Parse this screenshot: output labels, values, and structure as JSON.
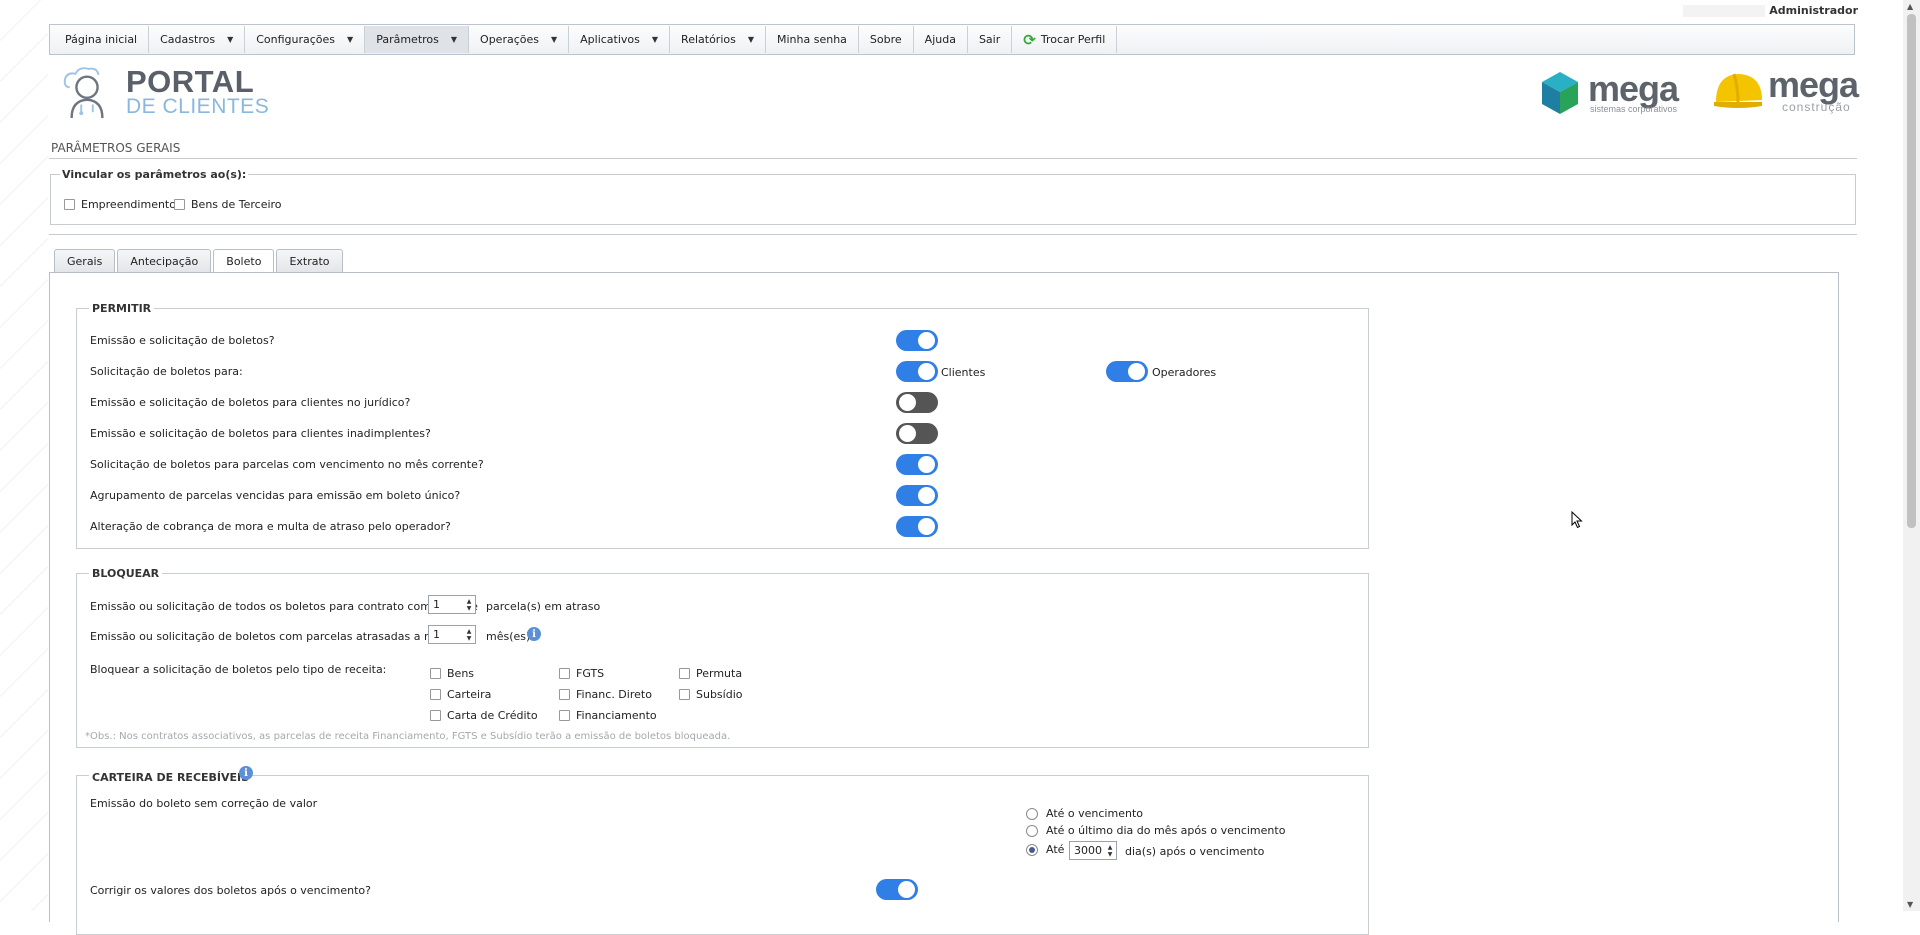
{
  "user": {
    "name": "Administrador"
  },
  "menu": [
    {
      "label": "Página inicial",
      "caret": false
    },
    {
      "label": "Cadastros",
      "caret": true
    },
    {
      "label": "Configurações",
      "caret": true
    },
    {
      "label": "Parâmetros",
      "caret": true,
      "active": true
    },
    {
      "label": "Operações",
      "caret": true
    },
    {
      "label": "Aplicativos",
      "caret": true
    },
    {
      "label": "Relatórios",
      "caret": true
    },
    {
      "label": "Minha senha",
      "caret": false
    },
    {
      "label": "Sobre",
      "caret": false
    },
    {
      "label": "Ajuda",
      "caret": false
    },
    {
      "label": "Sair",
      "caret": false
    },
    {
      "label": "Trocar Perfil",
      "caret": false,
      "icon": "swap-icon"
    }
  ],
  "logos": {
    "portal_line1": "PORTAL",
    "portal_line2": "DE CLIENTES",
    "mega1_word": "mega",
    "mega1_sub": "sistemas corporativos",
    "mega2_word": "mega",
    "mega2_sub": "construção"
  },
  "page_title": "PARÂMETROS GERAIS",
  "vincular": {
    "legend": "Vincular os parâmetros ao(s):",
    "options": [
      "Empreendimento",
      "Bens de Terceiro"
    ]
  },
  "tabs": [
    {
      "label": "Gerais"
    },
    {
      "label": "Antecipação"
    },
    {
      "label": "Boleto",
      "active": true
    },
    {
      "label": "Extrato"
    }
  ],
  "permitir": {
    "legend": "PERMITIR",
    "rows": [
      {
        "label": "Emissão e solicitação de boletos?",
        "on": true
      },
      {
        "label": "Solicitação de boletos para:",
        "on": true,
        "extra_label": "Clientes",
        "second_label": "Operadores",
        "second_on": true
      },
      {
        "label": "Emissão e solicitação de boletos para clientes no jurídico?",
        "on": false
      },
      {
        "label": "Emissão e solicitação de boletos para clientes inadimplentes?",
        "on": false
      },
      {
        "label": "Solicitação de boletos para parcelas com vencimento no mês corrente?",
        "on": true
      },
      {
        "label": "Agrupamento de parcelas vencidas para emissão em boleto único?",
        "on": true
      },
      {
        "label": "Alteração de cobrança de mora e multa de atraso pelo operador?",
        "on": true
      }
    ]
  },
  "bloquear": {
    "legend": "BLOQUEAR",
    "row1": {
      "label": "Emissão ou solicitação de todos os boletos para contrato com mais de",
      "value": "1",
      "suffix": "parcela(s) em atraso"
    },
    "row2": {
      "label": "Emissão ou solicitação de boletos com parcelas atrasadas a mais de",
      "value": "1",
      "suffix": "mês(es)"
    },
    "receita_label": "Bloquear a solicitação de boletos pelo tipo de receita:",
    "receitas": [
      "Bens",
      "FGTS",
      "Permuta",
      "Carteira",
      "Financ. Direto",
      "Subsídio",
      "Carta de Crédito",
      "Financiamento"
    ],
    "obs": "*Obs.: Nos contratos associativos, as parcelas de receita Financiamento, FGTS e Subsídio terão a emissão de boletos bloqueada."
  },
  "carteira": {
    "legend": "CARTEIRA DE RECEBÍVEIS",
    "emissao_label": "Emissão do boleto sem correção de valor",
    "radios": [
      {
        "label": "Até o vencimento",
        "on": false
      },
      {
        "label": "Até o último dia do mês após o vencimento",
        "on": false
      },
      {
        "label_pre": "Até",
        "value": "3000",
        "label_post": "dia(s) após o vencimento",
        "on": true
      }
    ],
    "corrigir_label": "Corrigir os valores dos boletos após o vencimento?",
    "corrigir_on": true
  }
}
